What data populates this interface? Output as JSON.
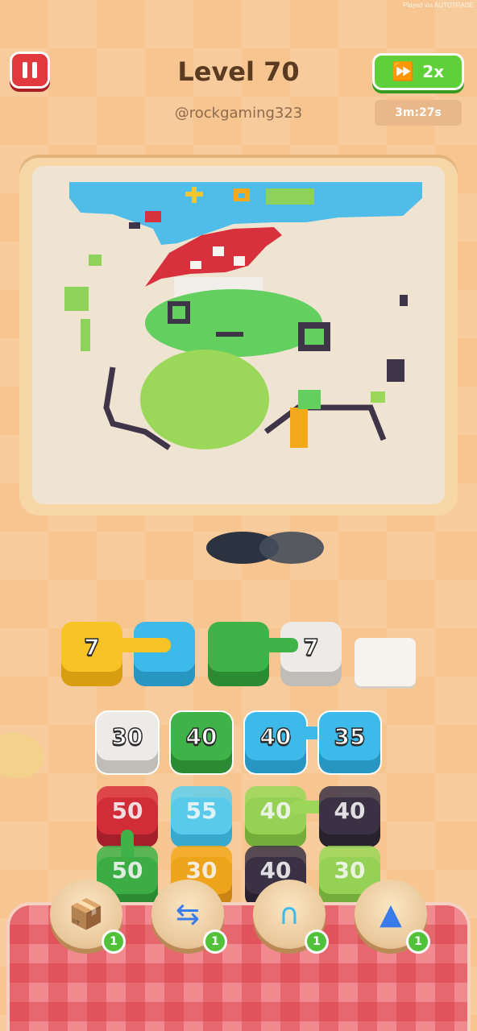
{
  "watermark": "Played via AUTOTRADE",
  "header": {
    "level_title": "Level 70",
    "username": "@rockgaming323",
    "speed_label": "2x",
    "timer": "3m:27s"
  },
  "colors": {
    "yellow": "#f7c325",
    "blue": "#3ebaea",
    "green": "#3fb348",
    "lime": "#9bd85a",
    "red": "#d8303c",
    "dark": "#3e3548",
    "white": "#ecebe8",
    "orange": "#f4a91c",
    "lightblue": "#5fd0ef"
  },
  "queue": [
    {
      "color": "yellow",
      "label": "7"
    },
    {
      "color": "blue",
      "label": ""
    },
    {
      "color": "green",
      "label": ""
    },
    {
      "color": "white",
      "label": "7"
    }
  ],
  "grid": {
    "row1": [
      {
        "color": "white",
        "label": "30"
      },
      {
        "color": "green",
        "label": "40"
      },
      {
        "color": "blue",
        "label": "40"
      },
      {
        "color": "blue",
        "label": "35"
      }
    ],
    "row2": [
      {
        "color": "red",
        "label": "50"
      },
      {
        "color": "lightblue",
        "label": "55"
      },
      {
        "color": "lime",
        "label": "40"
      },
      {
        "color": "dark",
        "label": "40"
      }
    ],
    "row3": [
      {
        "color": "green",
        "label": "50"
      },
      {
        "color": "orange",
        "label": "30"
      },
      {
        "color": "dark",
        "label": "40"
      },
      {
        "color": "lime",
        "label": "30"
      }
    ]
  },
  "boosters": [
    {
      "name": "add-slot",
      "icon": "box-plus-icon",
      "count": "1"
    },
    {
      "name": "shuffle",
      "icon": "shuffle-arrows-icon",
      "count": "1"
    },
    {
      "name": "magnet",
      "icon": "magnet-icon",
      "count": "1"
    },
    {
      "name": "vacuum",
      "icon": "vacuum-icon",
      "count": "1"
    }
  ]
}
